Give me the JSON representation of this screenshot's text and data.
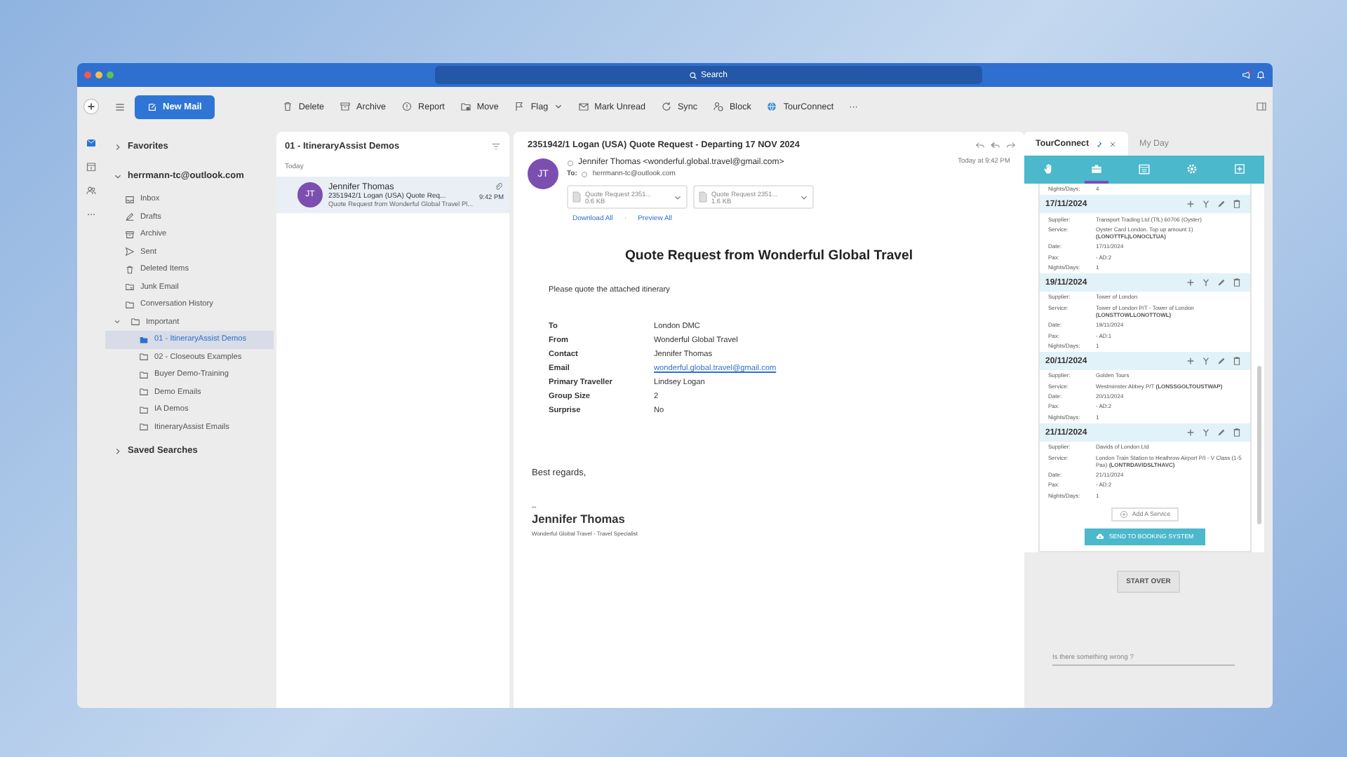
{
  "window": {
    "search": "Search"
  },
  "toolbar": {
    "new_mail": "New Mail",
    "more": "···",
    "actions": [
      {
        "label": "Delete",
        "kind": "trash",
        "caret": false
      },
      {
        "label": "Archive",
        "kind": "archive",
        "caret": false
      },
      {
        "label": "Report",
        "kind": "report",
        "caret": false
      },
      {
        "label": "Move",
        "kind": "move",
        "caret": false
      },
      {
        "label": "Flag",
        "kind": "flag",
        "caret": true
      },
      {
        "label": "Mark Unread",
        "kind": "envelope",
        "caret": false
      },
      {
        "label": "Sync",
        "kind": "sync",
        "caret": false
      },
      {
        "label": "Block",
        "kind": "block",
        "caret": false
      },
      {
        "label": "TourConnect",
        "kind": "globe",
        "caret": false
      }
    ]
  },
  "sidebar": {
    "sections": [
      {
        "label": "Favorites",
        "expanded": false
      },
      {
        "label": "herrmann-tc@outlook.com",
        "expanded": true,
        "children": [
          {
            "label": "Inbox",
            "kind": "inbox",
            "selected": false
          },
          {
            "label": "Drafts",
            "kind": "drafts",
            "selected": false
          },
          {
            "label": "Archive",
            "kind": "archive",
            "selected": false
          },
          {
            "label": "Sent",
            "kind": "sent",
            "selected": false
          },
          {
            "label": "Deleted Items",
            "kind": "trash",
            "selected": false
          },
          {
            "label": "Junk Email",
            "kind": "junk",
            "selected": false
          },
          {
            "label": "Conversation History",
            "kind": "folder",
            "selected": false
          },
          {
            "label": "Important",
            "kind": "folder",
            "selected": false,
            "expanded": true,
            "children": [
              {
                "label": "01 - ItineraryAssist Demos",
                "kind": "folder",
                "selected": true
              },
              {
                "label": "02 - Closeouts Examples",
                "kind": "folder",
                "selected": false
              },
              {
                "label": "Buyer Demo-Training",
                "kind": "folder",
                "selected": false
              },
              {
                "label": "Demo Emails",
                "kind": "folder",
                "selected": false
              },
              {
                "label": "IA Demos",
                "kind": "folder",
                "selected": false
              },
              {
                "label": "ItineraryAssist Emails",
                "kind": "folder",
                "selected": false
              }
            ]
          }
        ]
      },
      {
        "label": "Saved Searches",
        "expanded": false
      }
    ]
  },
  "message_list": {
    "title": "01 - ItineraryAssist Demos",
    "group": "Today",
    "messages": [
      {
        "initials": "JT",
        "sender": "Jennifer Thomas",
        "subject": "2351942/1 Logan (USA) Quote Req...",
        "time": "9:42 PM",
        "preview": "Quote Request from Wonderful Global Travel Pl...",
        "attachment": true,
        "selected": true
      }
    ]
  },
  "reading_pane": {
    "subject": "2351942/1 Logan (USA) Quote Request - Departing 17 NOV 2024",
    "initials": "JT",
    "from": "Jennifer Thomas <wonderful.global.travel@gmail.com>",
    "to_label": "To:",
    "to": "herrmann-tc@outlook.com",
    "time": "Today at 9:42 PM",
    "attachments": [
      {
        "name": "Quote Request 2351...",
        "size": "0.6 KB"
      },
      {
        "name": "Quote Request 2351...",
        "size": "1.6 KB"
      }
    ],
    "download_all": "Download All",
    "separator": "·",
    "preview_all": "Preview All",
    "body": {
      "heading": "Quote Request from Wonderful Global Travel",
      "intro": "Please quote the attached itinerary",
      "details": [
        {
          "label": "To",
          "value": "London DMC",
          "kind": "text"
        },
        {
          "label": "From",
          "value": "Wonderful Global Travel",
          "kind": "text"
        },
        {
          "label": "Contact",
          "value": "Jennifer Thomas",
          "kind": "text"
        },
        {
          "label": "Email",
          "value": "wonderful.global.travel@gmail.com",
          "kind": "link"
        },
        {
          "label": "Primary Traveller",
          "value": "Lindsey Logan",
          "kind": "text"
        },
        {
          "label": "Group Size",
          "value": "2",
          "kind": "text"
        },
        {
          "label": "Surprise",
          "value": "No",
          "kind": "text"
        }
      ],
      "closing": "Best regards,",
      "sig_dash": "--",
      "sig_name": "Jennifer Thomas",
      "sig_title": "Wonderful Global Travel - Travel Specialist"
    }
  },
  "tour_connect": {
    "tabs": [
      {
        "label": "TourConnect",
        "selected": true
      },
      {
        "label": "My Day",
        "selected": false
      }
    ],
    "icon_tabs": [
      {
        "kind": "hand",
        "selected": false
      },
      {
        "kind": "briefcase",
        "selected": true
      },
      {
        "kind": "calendar",
        "selected": false
      },
      {
        "kind": "gear",
        "selected": false
      },
      {
        "kind": "plus",
        "selected": false
      }
    ],
    "partial": {
      "label": "Nights/Days:",
      "value": "4"
    },
    "days": [
      {
        "date": "17/11/2024",
        "fields": [
          {
            "label": "Supplier:",
            "value": "Transport Trading Ltd (TfL) 60706 (Oyster)"
          },
          {
            "label": "Service:",
            "value": "Oyster Card London. Top up amount 1) **(LONOTTFL|LONOCLTUA)**"
          },
          {
            "label": "Date:",
            "value": "17/11/2024"
          },
          {
            "label": "Pax:",
            "value": "- AD:2"
          },
          {
            "label": "Nights/Days:",
            "value": "1"
          }
        ]
      },
      {
        "date": "19/11/2024",
        "fields": [
          {
            "label": "Supplier:",
            "value": "Tower of London"
          },
          {
            "label": "Service:",
            "value": "Tower of London P/T - Tower of London **(LONSTTOWLLONOTTOWL)**"
          },
          {
            "label": "Date:",
            "value": "19/11/2024"
          },
          {
            "label": "Pax:",
            "value": "- AD:1"
          },
          {
            "label": "Nights/Days:",
            "value": "1"
          }
        ]
      },
      {
        "date": "20/11/2024",
        "fields": [
          {
            "label": "Supplier:",
            "value": "Golden Tours"
          },
          {
            "label": "Service:",
            "value": "Westminster Abbey P/T **(LONSSGOLTOUSTWAP)**"
          },
          {
            "label": "Date:",
            "value": "20/11/2024"
          },
          {
            "label": "Pax:",
            "value": "- AD:2"
          },
          {
            "label": "Nights/Days:",
            "value": "1"
          }
        ]
      },
      {
        "date": "21/11/2024",
        "fields": [
          {
            "label": "Supplier:",
            "value": "Davids of London Ltd"
          },
          {
            "label": "Service:",
            "value": "London Train Station to Heathrow Airport P/I - V Class (1-5 Pax) **(LONTRDAVIDSLTHAVC)**"
          },
          {
            "label": "Date:",
            "value": "21/11/2024"
          },
          {
            "label": "Pax:",
            "value": "- AD:2"
          },
          {
            "label": "Nights/Days:",
            "value": "1"
          }
        ]
      }
    ],
    "add_service": "Add A Service",
    "send": "SEND TO BOOKING SYSTEM",
    "start_over": "START OVER",
    "problem": "Is there something wrong ?"
  }
}
